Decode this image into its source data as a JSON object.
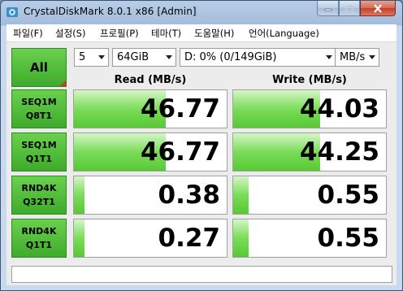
{
  "window": {
    "title": "CrystalDiskMark 8.0.1 x86 [Admin]"
  },
  "menu": [
    "파일(F)",
    "설정(S)",
    "프로필(P)",
    "테마(T)",
    "도움말(H)",
    "언어(Language)"
  ],
  "controls": {
    "all_label": "All",
    "count": "5",
    "size": "64GiB",
    "drive": "D: 0% (0/149GiB)",
    "unit": "MB/s"
  },
  "headers": {
    "read": "Read (MB/s)",
    "write": "Write (MB/s)"
  },
  "tests": [
    {
      "line1": "SEQ1M",
      "line2": "Q8T1",
      "read": "46.77",
      "write": "44.03",
      "read_bar": 0.6,
      "write_bar": 0.57
    },
    {
      "line1": "SEQ1M",
      "line2": "Q1T1",
      "read": "46.77",
      "write": "44.25",
      "read_bar": 0.6,
      "write_bar": 0.57
    },
    {
      "line1": "RND4K",
      "line2": "Q32T1",
      "read": "0.38",
      "write": "0.55",
      "read_bar": 0.07,
      "write_bar": 0.1
    },
    {
      "line1": "RND4K",
      "line2": "Q1T1",
      "read": "0.27",
      "write": "0.55",
      "read_bar": 0.07,
      "write_bar": 0.1
    }
  ],
  "comment": "",
  "colors": {
    "green": "#3faa2b",
    "bar": "#57c933",
    "accent_corner": "#d23b15"
  }
}
